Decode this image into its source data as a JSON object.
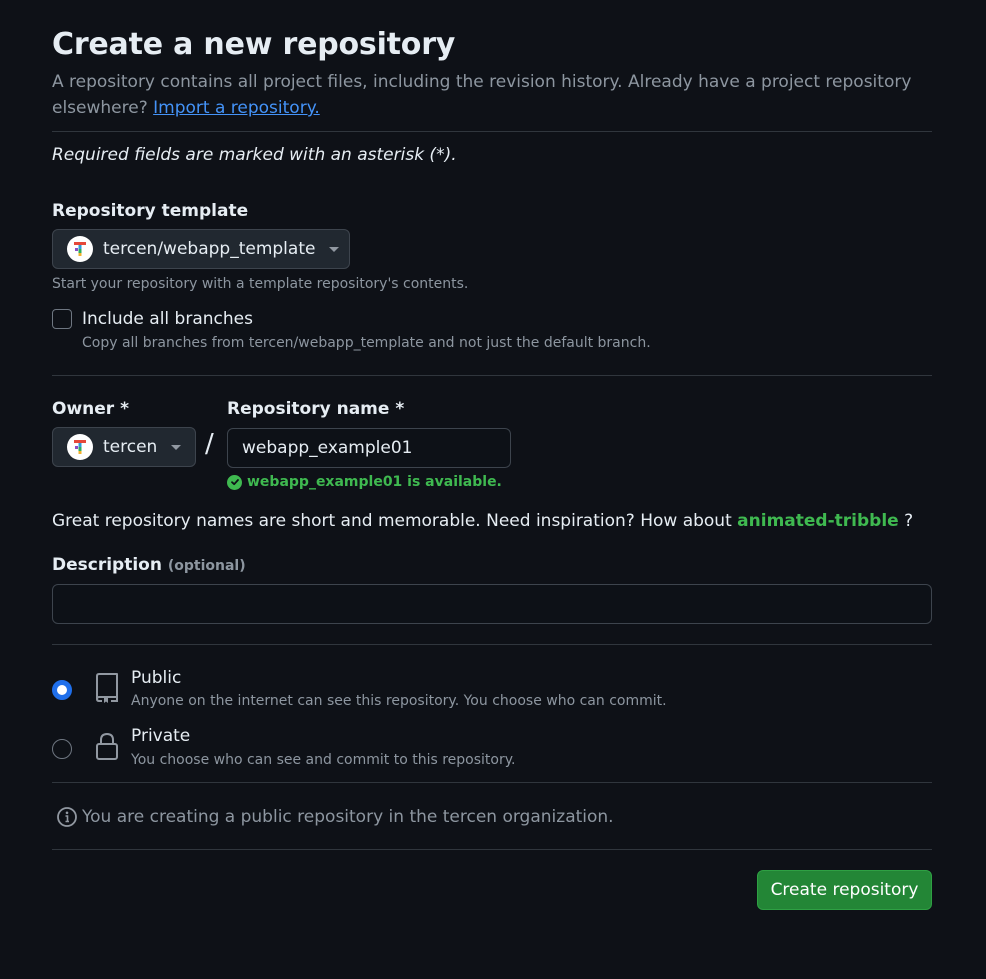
{
  "header": {
    "title": "Create a new repository",
    "intro_text": "A repository contains all project files, including the revision history. Already have a project repository elsewhere?",
    "import_link": "Import a repository."
  },
  "required_note": "Required fields are marked with an asterisk (*).",
  "template": {
    "label": "Repository template",
    "selected": "tercen/webapp_template",
    "hint": "Start your repository with a template repository's contents.",
    "include_branches_label": "Include all branches",
    "include_branches_checked": false,
    "include_branches_hint": "Copy all branches from tercen/webapp_template and not just the default branch."
  },
  "owner": {
    "label": "Owner *",
    "selected": "tercen"
  },
  "separator": "/",
  "repo_name": {
    "label": "Repository name *",
    "value": "webapp_example01",
    "availability": "webapp_example01 is available."
  },
  "inspiration": {
    "text": "Great repository names are short and memorable. Need inspiration? How about",
    "suggestion": "animated-tribble",
    "suffix": "?"
  },
  "description": {
    "label": "Description",
    "optional": "(optional)",
    "value": ""
  },
  "visibility": {
    "selected": "public",
    "options": [
      {
        "title": "Public",
        "desc": "Anyone on the internet can see this repository. You choose who can commit.",
        "icon": "repo-icon"
      },
      {
        "title": "Private",
        "desc": "You choose who can see and commit to this repository.",
        "icon": "lock-icon"
      }
    ]
  },
  "info_note": "You are creating a public repository in the tercen organization.",
  "submit_label": "Create repository",
  "colors": {
    "background": "#0e1117",
    "accent_green": "#238636",
    "success_text": "#3fb950",
    "link": "#4493f8",
    "radio_selected": "#1f6feb"
  }
}
